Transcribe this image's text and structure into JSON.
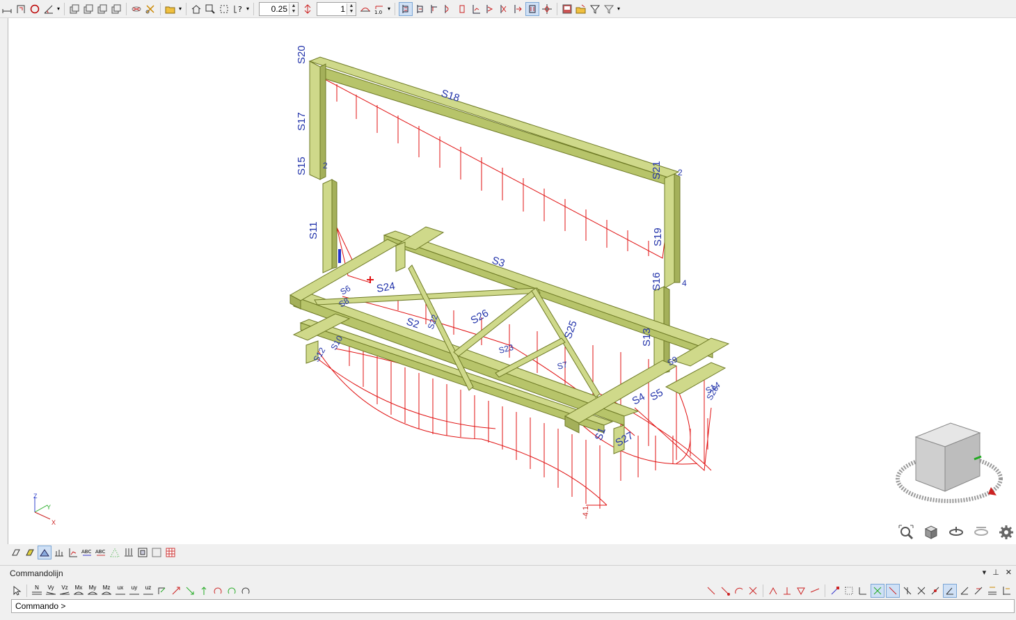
{
  "toolbar": {
    "scale_value": "0.25",
    "count_value": "1",
    "colors": {
      "active_bg": "#cfe0f5"
    }
  },
  "viewport": {
    "member_labels": [
      "S20",
      "S18",
      "S17",
      "S15",
      "S21",
      "S11",
      "S19",
      "S3",
      "S16",
      "S24",
      "S2",
      "S26",
      "S25",
      "S4",
      "S13",
      "S5",
      "S1",
      "S27"
    ],
    "partial_labels": [
      "S6",
      "S8",
      "S10",
      "S22",
      "S23",
      "S7",
      "S9",
      "S14",
      "S12",
      "S28"
    ],
    "node_numbers": [
      "2",
      "4",
      "2"
    ],
    "value_label": "-4.1",
    "axis": {
      "z": "Z",
      "y": "Y",
      "x": "X"
    },
    "colors": {
      "member_fill": "#cfd98a",
      "member_edge": "#6e7a26",
      "diagram": "#e01010",
      "label": "#2233aa"
    }
  },
  "command": {
    "title": "Commandolijn",
    "prompt": "Commando > ",
    "input_value": "",
    "icon_labels": [
      "N",
      "Vy",
      "Vz",
      "Mx",
      "My",
      "Mz",
      "ux",
      "uy",
      "uz"
    ]
  }
}
